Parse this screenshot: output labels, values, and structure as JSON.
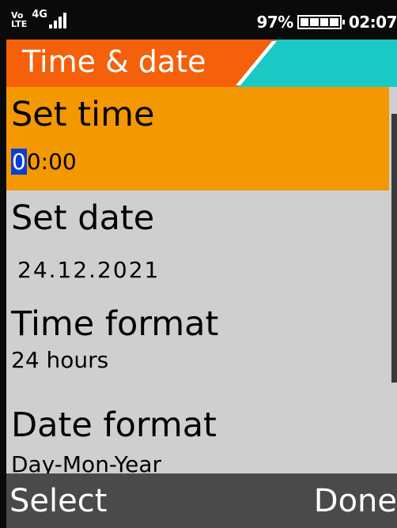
{
  "status": {
    "volte_top": "Vo",
    "volte_bottom": "LTE",
    "network": "4G",
    "battery": "97%",
    "time": "02:07"
  },
  "title": "Time & date",
  "items": [
    {
      "label": "Set time",
      "value_cursor": "0",
      "value_rest": "0:00"
    },
    {
      "label": "Set date",
      "value": "24.12.2021"
    },
    {
      "label": "Time format",
      "value": "24 hours"
    },
    {
      "label": "Date format",
      "value": "Day-Mon-Year"
    }
  ],
  "softkeys": {
    "left": "Select",
    "right": "Done"
  },
  "colors": {
    "title_orange": "#f5600a",
    "title_teal": "#1bc9c4",
    "selected": "#f39800",
    "cursor": "#0a3fd6"
  }
}
